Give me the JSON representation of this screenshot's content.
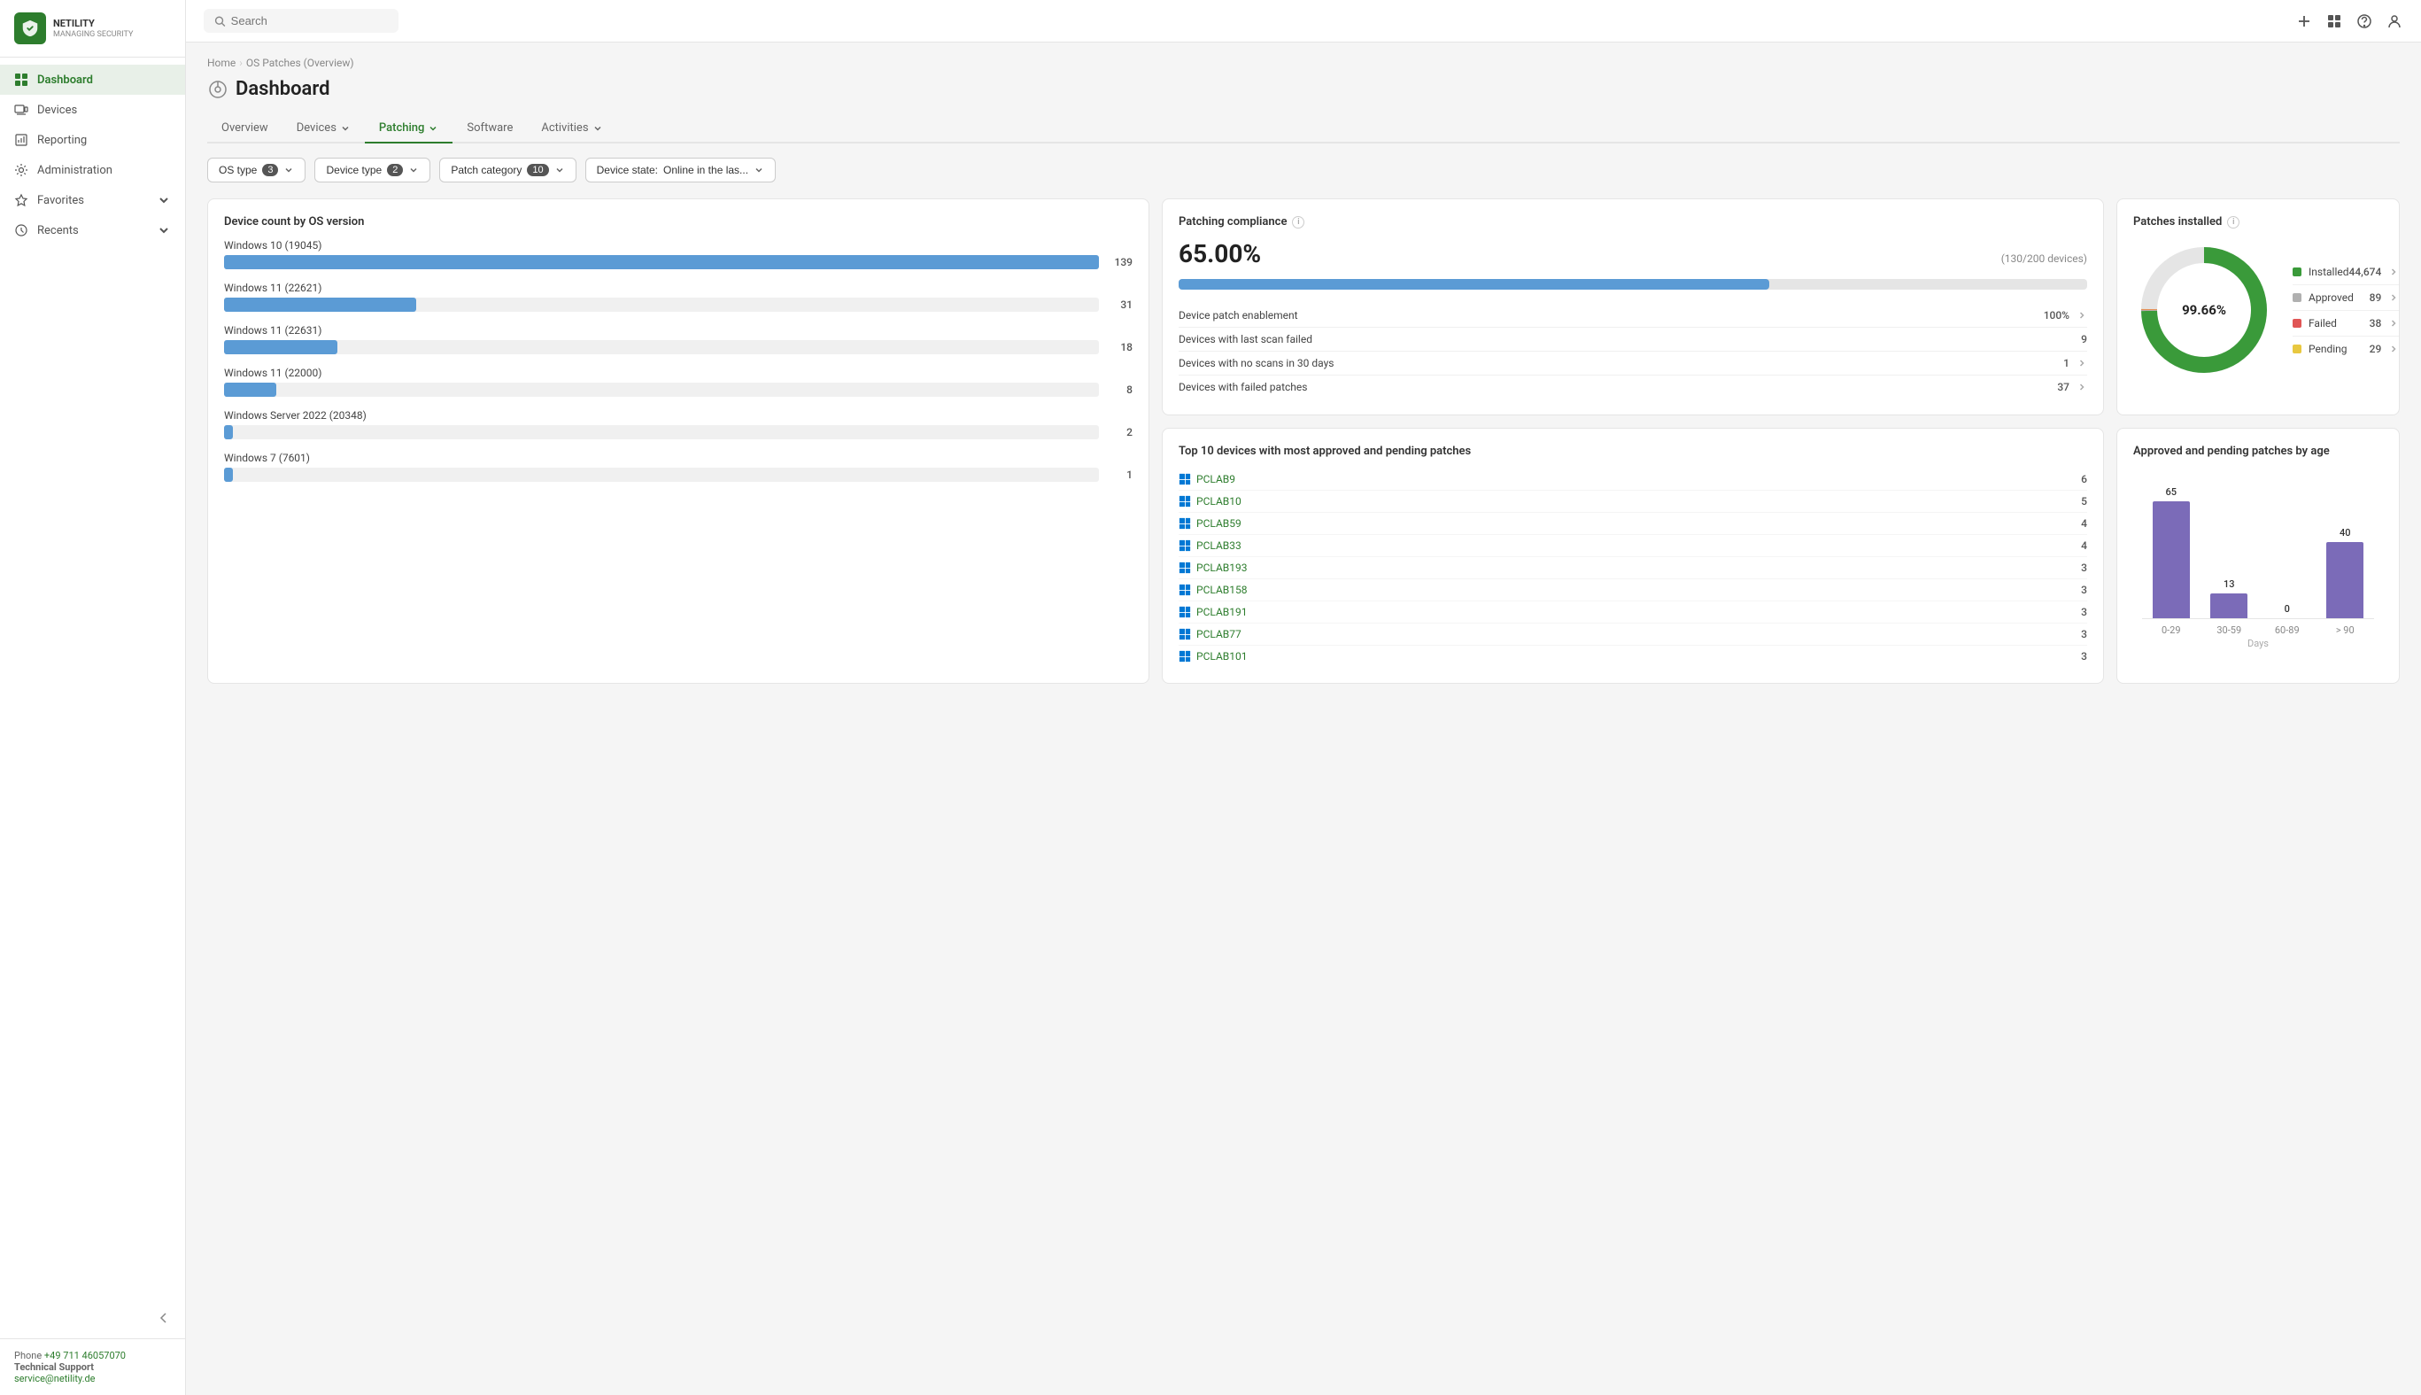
{
  "app": {
    "logo_text": "NETILITY",
    "logo_sub": "MANAGING SECURITY"
  },
  "sidebar": {
    "items": [
      {
        "id": "dashboard",
        "label": "Dashboard",
        "active": true
      },
      {
        "id": "devices",
        "label": "Devices",
        "active": false
      },
      {
        "id": "reporting",
        "label": "Reporting",
        "active": false
      },
      {
        "id": "administration",
        "label": "Administration",
        "active": false
      },
      {
        "id": "favorites",
        "label": "Favorites",
        "active": false,
        "has_chevron": true
      },
      {
        "id": "recents",
        "label": "Recents",
        "active": false,
        "has_chevron": true
      }
    ]
  },
  "topbar": {
    "search_placeholder": "Search"
  },
  "breadcrumb": {
    "home": "Home",
    "current": "OS Patches (Overview)"
  },
  "page": {
    "title": "Dashboard"
  },
  "tabs": [
    {
      "id": "overview",
      "label": "Overview",
      "active": false
    },
    {
      "id": "devices",
      "label": "Devices",
      "active": false,
      "has_chevron": true
    },
    {
      "id": "patching",
      "label": "Patching",
      "active": true,
      "has_chevron": true
    },
    {
      "id": "software",
      "label": "Software",
      "active": false
    },
    {
      "id": "activities",
      "label": "Activities",
      "active": false,
      "has_chevron": true
    }
  ],
  "filters": [
    {
      "id": "os_type",
      "label": "OS type",
      "value": "3"
    },
    {
      "id": "device_type",
      "label": "Device type",
      "value": "2"
    },
    {
      "id": "patch_category",
      "label": "Patch category",
      "value": "10"
    },
    {
      "id": "device_state",
      "label": "Device state:",
      "value": "Online in the las..."
    }
  ],
  "compliance": {
    "title": "Patching compliance",
    "percent": "65.00%",
    "devices_text": "(130/200 devices)",
    "progress": 65,
    "stats": [
      {
        "label": "Device patch enablement",
        "value": "100%",
        "has_chevron": true
      },
      {
        "label": "Devices with last scan failed",
        "value": "9",
        "has_chevron": false
      },
      {
        "label": "Devices with no scans in 30 days",
        "value": "1",
        "has_chevron": true
      },
      {
        "label": "Devices with failed patches",
        "value": "37",
        "has_chevron": true
      }
    ]
  },
  "patches_installed": {
    "title": "Patches installed",
    "donut_label": "99.66%",
    "legend": [
      {
        "id": "installed",
        "label": "Installed",
        "value": "44,674",
        "color": "#3a9a3a"
      },
      {
        "id": "approved",
        "label": "Approved",
        "value": "89",
        "color": "#b0b0b0"
      },
      {
        "id": "failed",
        "label": "Failed",
        "value": "38",
        "color": "#e05555"
      },
      {
        "id": "pending",
        "label": "Pending",
        "value": "29",
        "color": "#e8c840"
      }
    ]
  },
  "top_devices": {
    "title": "Top 10 devices with most approved and pending patches",
    "devices": [
      {
        "name": "PCLAB9",
        "count": 6
      },
      {
        "name": "PCLAB10",
        "count": 5
      },
      {
        "name": "PCLAB59",
        "count": 4
      },
      {
        "name": "PCLAB33",
        "count": 4
      },
      {
        "name": "PCLAB193",
        "count": 3
      },
      {
        "name": "PCLAB158",
        "count": 3
      },
      {
        "name": "PCLAB191",
        "count": 3
      },
      {
        "name": "PCLAB77",
        "count": 3
      },
      {
        "name": "PCLAB101",
        "count": 3
      }
    ]
  },
  "age_chart": {
    "title": "Approved and pending patches by age",
    "bars": [
      {
        "label": "0-29",
        "value": 65,
        "height_pct": 100
      },
      {
        "label": "30-59",
        "value": 13,
        "height_pct": 20
      },
      {
        "label": "60-89",
        "value": 0,
        "height_pct": 0
      },
      {
        "label": "> 90",
        "value": 40,
        "height_pct": 61
      }
    ],
    "x_label": "Days"
  },
  "os_chart": {
    "title": "Device count by OS version",
    "max_val": 139,
    "items": [
      {
        "label": "Windows 10 (19045)",
        "value": 139
      },
      {
        "label": "Windows 11 (22621)",
        "value": 31
      },
      {
        "label": "Windows 11 (22631)",
        "value": 18
      },
      {
        "label": "Windows 11 (22000)",
        "value": 8
      },
      {
        "label": "Windows Server 2022 (20348)",
        "value": 2
      },
      {
        "label": "Windows 7 (7601)",
        "value": 1
      }
    ]
  },
  "footer": {
    "phone_label": "Phone",
    "phone_number": "+49 711 46057070",
    "support_label": "Technical Support",
    "support_email": "service@netility.de"
  }
}
